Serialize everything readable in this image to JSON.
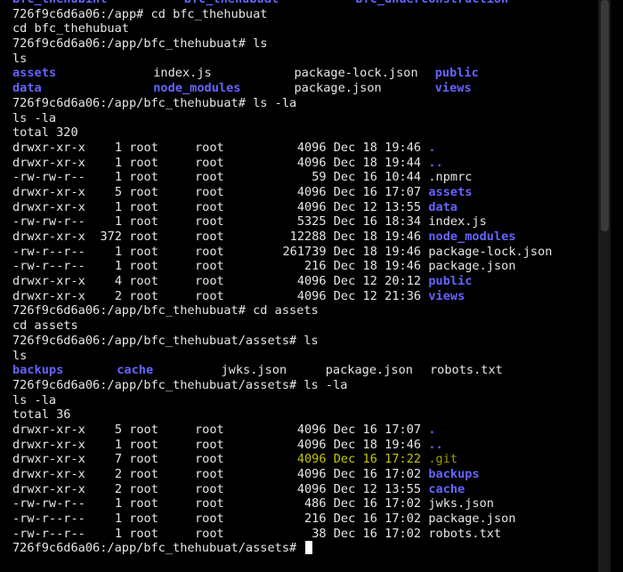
{
  "terminal": {
    "top_partial": [
      "bfc_thehubint",
      "bfc_thehubuat",
      "bfc_underconstruction"
    ],
    "blocks": [
      {
        "prompt": "726f9c6d6a06:/app#",
        "cmd": "cd bfc_thehubuat",
        "echo": "cd bfc_thehubuat"
      },
      {
        "prompt": "726f9c6d6a06:/app/bfc_thehubuat#",
        "cmd": "ls",
        "echo": "ls"
      }
    ],
    "ls_app": [
      [
        {
          "name": "assets",
          "dir": true
        },
        {
          "name": "index.js",
          "dir": false
        },
        {
          "name": "package-lock.json",
          "dir": false
        },
        {
          "name": "public",
          "dir": true
        }
      ],
      [
        {
          "name": "data",
          "dir": true
        },
        {
          "name": "node_modules",
          "dir": true
        },
        {
          "name": "package.json",
          "dir": false
        },
        {
          "name": "views",
          "dir": true
        }
      ]
    ],
    "cmd3": {
      "prompt": "726f9c6d6a06:/app/bfc_thehubuat#",
      "cmd": "ls -la",
      "echo": "ls -la"
    },
    "total1": "total 320",
    "listing1": [
      {
        "perm": "drwxr-xr-x",
        "links": "1",
        "user": "root",
        "group": "root",
        "size": "4096",
        "month": "Dec",
        "day": "18",
        "time": "19:46",
        "name": ".",
        "dir": true
      },
      {
        "perm": "drwxr-xr-x",
        "links": "1",
        "user": "root",
        "group": "root",
        "size": "4096",
        "month": "Dec",
        "day": "18",
        "time": "19:44",
        "name": "..",
        "dir": true
      },
      {
        "perm": "-rw-rw-r--",
        "links": "1",
        "user": "root",
        "group": "root",
        "size": "59",
        "month": "Dec",
        "day": "16",
        "time": "10:44",
        "name": ".npmrc",
        "dir": false
      },
      {
        "perm": "drwxr-xr-x",
        "links": "5",
        "user": "root",
        "group": "root",
        "size": "4096",
        "month": "Dec",
        "day": "16",
        "time": "17:07",
        "name": "assets",
        "dir": true
      },
      {
        "perm": "drwxr-xr-x",
        "links": "1",
        "user": "root",
        "group": "root",
        "size": "4096",
        "month": "Dec",
        "day": "12",
        "time": "13:55",
        "name": "data",
        "dir": true
      },
      {
        "perm": "-rw-rw-r--",
        "links": "1",
        "user": "root",
        "group": "root",
        "size": "5325",
        "month": "Dec",
        "day": "16",
        "time": "18:34",
        "name": "index.js",
        "dir": false
      },
      {
        "perm": "drwxr-xr-x",
        "links": "372",
        "user": "root",
        "group": "root",
        "size": "12288",
        "month": "Dec",
        "day": "18",
        "time": "19:46",
        "name": "node_modules",
        "dir": true
      },
      {
        "perm": "-rw-r--r--",
        "links": "1",
        "user": "root",
        "group": "root",
        "size": "261739",
        "month": "Dec",
        "day": "18",
        "time": "19:46",
        "name": "package-lock.json",
        "dir": false
      },
      {
        "perm": "-rw-r--r--",
        "links": "1",
        "user": "root",
        "group": "root",
        "size": "216",
        "month": "Dec",
        "day": "18",
        "time": "19:46",
        "name": "package.json",
        "dir": false
      },
      {
        "perm": "drwxr-xr-x",
        "links": "4",
        "user": "root",
        "group": "root",
        "size": "4096",
        "month": "Dec",
        "day": "12",
        "time": "20:12",
        "name": "public",
        "dir": true
      },
      {
        "perm": "drwxr-xr-x",
        "links": "2",
        "user": "root",
        "group": "root",
        "size": "4096",
        "month": "Dec",
        "day": "12",
        "time": "21:36",
        "name": "views",
        "dir": true
      }
    ],
    "cmd4": {
      "prompt": "726f9c6d6a06:/app/bfc_thehubuat#",
      "cmd": "cd assets",
      "echo": "cd assets"
    },
    "cmd5": {
      "prompt": "726f9c6d6a06:/app/bfc_thehubuat/assets#",
      "cmd": "ls",
      "echo": "ls"
    },
    "ls_assets": [
      {
        "name": "backups",
        "dir": true
      },
      {
        "name": "cache",
        "dir": true
      },
      {
        "name": "jwks.json",
        "dir": false
      },
      {
        "name": "package.json",
        "dir": false
      },
      {
        "name": "robots.txt",
        "dir": false
      }
    ],
    "cmd6": {
      "prompt": "726f9c6d6a06:/app/bfc_thehubuat/assets#",
      "cmd": "ls -la",
      "echo": "ls -la"
    },
    "total2": "total 36",
    "listing2": [
      {
        "perm": "drwxr-xr-x",
        "links": "5",
        "user": "root",
        "group": "root",
        "size": "4096",
        "month": "Dec",
        "day": "16",
        "time": "17:07",
        "name": ".",
        "dir": true
      },
      {
        "perm": "drwxr-xr-x",
        "links": "1",
        "user": "root",
        "group": "root",
        "size": "4096",
        "month": "Dec",
        "day": "18",
        "time": "19:46",
        "name": "..",
        "dir": true
      },
      {
        "perm": "drwxr-xr-x",
        "links": "7",
        "user": "root",
        "group": "root",
        "size": "4096",
        "month": "Dec",
        "day": "16",
        "time": "17:22",
        "name": ".git",
        "dir": false,
        "highlight": true
      },
      {
        "perm": "drwxr-xr-x",
        "links": "2",
        "user": "root",
        "group": "root",
        "size": "4096",
        "month": "Dec",
        "day": "16",
        "time": "17:02",
        "name": "backups",
        "dir": true
      },
      {
        "perm": "drwxr-xr-x",
        "links": "2",
        "user": "root",
        "group": "root",
        "size": "4096",
        "month": "Dec",
        "day": "12",
        "time": "13:55",
        "name": "cache",
        "dir": true
      },
      {
        "perm": "-rw-rw-r--",
        "links": "1",
        "user": "root",
        "group": "root",
        "size": "486",
        "month": "Dec",
        "day": "16",
        "time": "17:02",
        "name": "jwks.json",
        "dir": false
      },
      {
        "perm": "-rw-r--r--",
        "links": "1",
        "user": "root",
        "group": "root",
        "size": "216",
        "month": "Dec",
        "day": "16",
        "time": "17:02",
        "name": "package.json",
        "dir": false
      },
      {
        "perm": "-rw-r--r--",
        "links": "1",
        "user": "root",
        "group": "root",
        "size": "38",
        "month": "Dec",
        "day": "16",
        "time": "17:02",
        "name": "robots.txt",
        "dir": false
      }
    ],
    "final_prompt": "726f9c6d6a06:/app/bfc_thehubuat/assets#"
  },
  "colors": {
    "background": "#000000",
    "text": "#e6e6e6",
    "directory": "#6464ff",
    "git_highlight": "#c5c500"
  }
}
